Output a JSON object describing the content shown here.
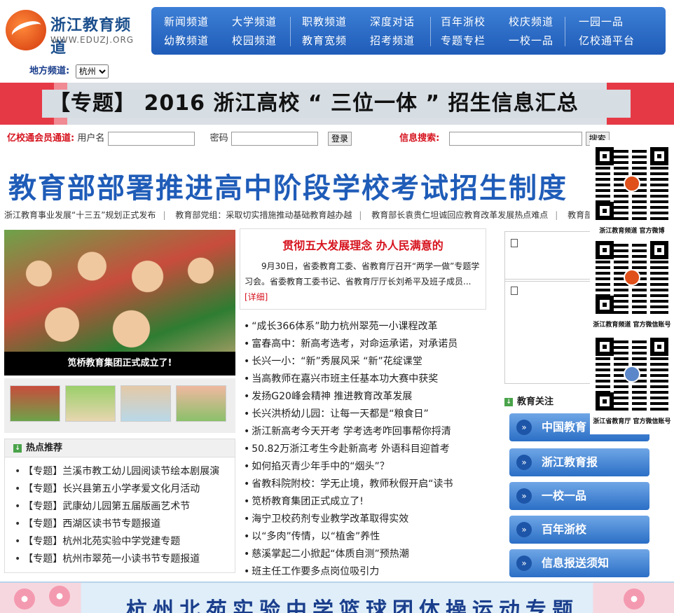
{
  "site": {
    "title": "浙江教育频道",
    "url": "WWW.EDUZJ.ORG"
  },
  "nav": [
    [
      "新闻频道",
      "大学频道",
      "幼教频道",
      "校园频道"
    ],
    [
      "职教频道",
      "深度对话",
      "教育宽频",
      "招考频道"
    ],
    [
      "百年浙校",
      "校庆频道",
      "专题专栏",
      "一校一品"
    ],
    [
      "一园一品",
      "亿校通平台"
    ]
  ],
  "local": {
    "label": "地方频道:",
    "selected": "杭州"
  },
  "banner": {
    "text": "【专题】 2016 浙江高校 “ 三位一体 ” 招生信息汇总"
  },
  "login": {
    "channel_label": "亿校通会员通道:",
    "user_label": "用户名",
    "password_label": "密码",
    "login_button": "登录",
    "search_label": "信息搜索:",
    "search_button": "搜索"
  },
  "headline": "教育部部署推进高中阶段学校考试招生制度",
  "ticker": [
    "浙江教育事业发展“十三五”规划正式发布",
    "教育部党组：采取切实措施推动基础教育越办越",
    "教育部长袁贵仁坦诚回应教育改革发展热点难点",
    "教育部党"
  ],
  "photo": {
    "caption": "笕桥教育集团正式成立了!"
  },
  "hot": {
    "title": "热点推荐",
    "items": [
      "【专题】兰溪市教工幼儿园阅读节绘本剧展演",
      "【专题】长兴县第五小学孝爱文化月活动",
      "【专题】武康幼儿园第五届版画艺术节",
      "【专题】西湖区读书节专题报道",
      "【专题】杭州北苑实验中学党建专题",
      "【专题】杭州市翠苑一小读书节专题报道"
    ]
  },
  "feature": {
    "title": "贯彻五大发展理念  办人民满意的",
    "text": "9月30日，省委教育工委、省教育厅召开“两学一做”专题学习会。省委教育工委书记、省教育厅厅长刘希平及班子成员...",
    "more": "[详细]"
  },
  "news": [
    "“成长366体系”助力杭州翠苑一小课程改革",
    "富春高中：新高考选考，对命运承诺，对承诺员",
    "长兴一小：“新”秀展风采  “新”花绽课堂",
    "当高教师在嘉兴市班主任基本功大赛中获奖",
    "发扬G20峰会精神  推进教育改革发展",
    "长兴洪桥幼儿园：让每一天都是“粮食日”",
    "浙江新高考今天开考  学考选考咋回事帮你捋清",
    "50.82万浙江考生今赴新高考  外语科目迎首考",
    "如何掐灭青少年手中的“烟头”？",
    "省教科院附校：学无止境，教师秋假开启“读书",
    "笕桥教育集团正式成立了!",
    "海宁卫校药剂专业教学改革取得实效",
    "以“多肉”传情，以“植舍”养性",
    "慈溪掌起二小掀起“体质自测”预热潮",
    "班主任工作要多点岗位吸引力"
  ],
  "focus": {
    "title": "教育关注",
    "buttons": [
      "中国教育",
      "浙江教育报",
      "一校一品",
      "百年浙校",
      "信息报送须知"
    ]
  },
  "qr": [
    "浙江教育频道 官方微博",
    "浙江教育频道 官方微信账号",
    "浙江省教育厅 官方微信账号"
  ],
  "bottom_banner": {
    "text": "杭州北苑实验中学篮球团体操运动专题"
  }
}
